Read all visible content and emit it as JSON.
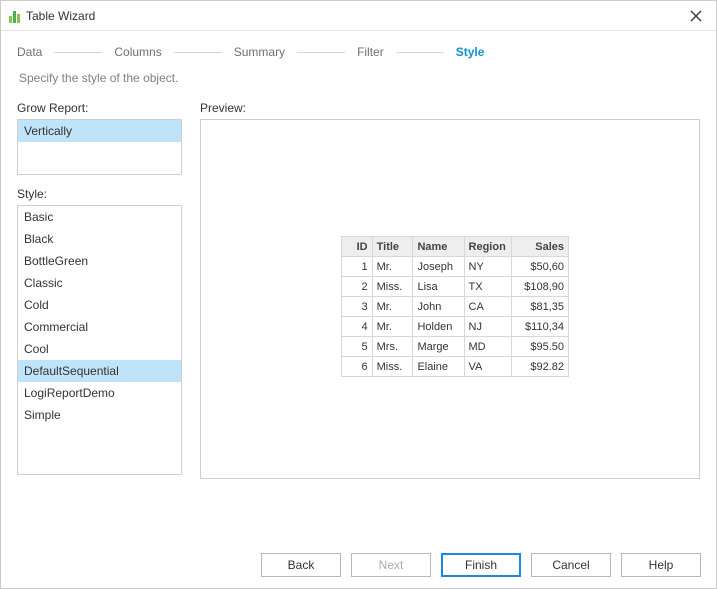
{
  "window": {
    "title": "Table Wizard"
  },
  "steps": {
    "data": "Data",
    "columns": "Columns",
    "summary": "Summary",
    "filter": "Filter",
    "style": "Style"
  },
  "subtitle": "Specify the style of the object.",
  "left": {
    "grow_label": "Grow Report:",
    "grow_items": [
      "Vertically"
    ],
    "grow_selected": 0,
    "style_label": "Style:",
    "style_items": [
      "Basic",
      "Black",
      "BottleGreen",
      "Classic",
      "Cold",
      "Commercial",
      "Cool",
      "DefaultSequential",
      "LogiReportDemo",
      "Simple"
    ],
    "style_selected": 7
  },
  "preview": {
    "label": "Preview:",
    "headers": [
      "ID",
      "Title",
      "Name",
      "Region",
      "Sales"
    ],
    "rows": [
      {
        "id": "1",
        "title": "Mr.",
        "name": "Joseph",
        "region": "NY",
        "sales": "$50,60"
      },
      {
        "id": "2",
        "title": "Miss.",
        "name": "Lisa",
        "region": "TX",
        "sales": "$108,90"
      },
      {
        "id": "3",
        "title": "Mr.",
        "name": "John",
        "region": "CA",
        "sales": "$81,35"
      },
      {
        "id": "4",
        "title": "Mr.",
        "name": "Holden",
        "region": "NJ",
        "sales": "$110,34"
      },
      {
        "id": "5",
        "title": "Mrs.",
        "name": "Marge",
        "region": "MD",
        "sales": "$95.50"
      },
      {
        "id": "6",
        "title": "Miss.",
        "name": "Elaine",
        "region": "VA",
        "sales": "$92.82"
      }
    ]
  },
  "buttons": {
    "back": "Back",
    "next": "Next",
    "finish": "Finish",
    "cancel": "Cancel",
    "help": "Help"
  }
}
